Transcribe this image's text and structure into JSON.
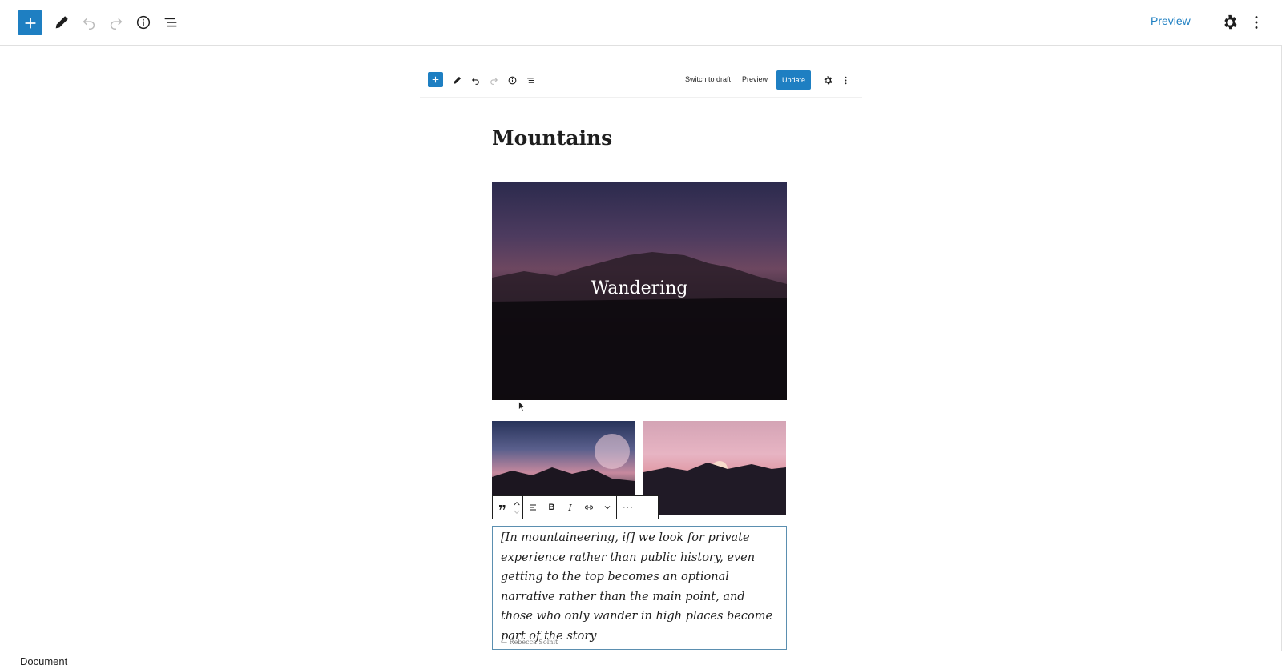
{
  "header": {
    "add_block_icon": "plus-icon",
    "tools_icon": "pencil-icon",
    "undo_icon": "undo-icon",
    "redo_icon": "redo-icon",
    "details_icon": "info-icon",
    "list_view_icon": "list-view-icon",
    "preview_label": "Preview",
    "settings_icon": "gear-icon",
    "options_icon": "kebab-menu-icon",
    "accent_color": "#1e7fc2"
  },
  "embedded_editor": {
    "switch_to_draft_label": "Switch to draft",
    "preview_label": "Preview",
    "update_label": "Update"
  },
  "post": {
    "title": "Mountains",
    "cover_text": "Wandering"
  },
  "block_toolbar": {
    "block_type_icon": "quote-icon",
    "move_up_icon": "chevron-up-icon",
    "move_down_icon": "chevron-down-icon",
    "align_icon": "align-left-icon",
    "bold_label": "B",
    "italic_label": "I",
    "link_icon": "link-icon",
    "more_rich_text_icon": "chevron-down-icon",
    "more_options_label": "···"
  },
  "quote": {
    "text": "[In mountaineering, if] we look for private experience rather than public history, even getting to the top becomes an optional narrative rather than the main point, and those who only wander in high places become part of the story",
    "citation": "— Rebecca Solnit"
  },
  "footer": {
    "breadcrumb": "Document"
  }
}
